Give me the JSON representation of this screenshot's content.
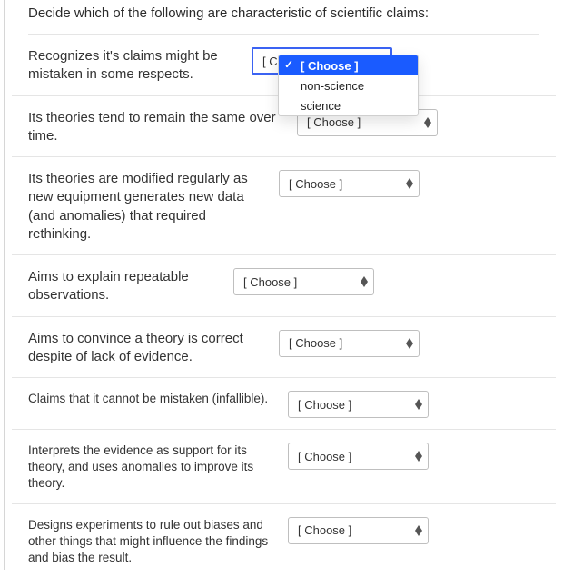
{
  "instruction": "Decide which of the following are characteristic of scientific claims:",
  "choose_label": "[ Choose ]",
  "dropdown_options": {
    "placeholder": "[ Choose ]",
    "opt1": "non-science",
    "opt2": "science"
  },
  "items": {
    "q1": "Recognizes it's claims might be mistaken in some respects.",
    "q2": "Its theories tend to remain the same over time.",
    "q3": "Its theories are modified regularly as new equipment generates new data (and anomalies) that required rethinking.",
    "q4": "Aims to explain repeatable observations.",
    "q5": "Aims to convince a theory is correct despite of lack of evidence.",
    "q6": "Claims that it cannot be mistaken (infallible).",
    "q7": "Interprets the evidence as support for its theory, and uses anomalies to improve its theory.",
    "q8": "Designs experiments to rule out biases and other things that might influence the findings and bias the result."
  }
}
